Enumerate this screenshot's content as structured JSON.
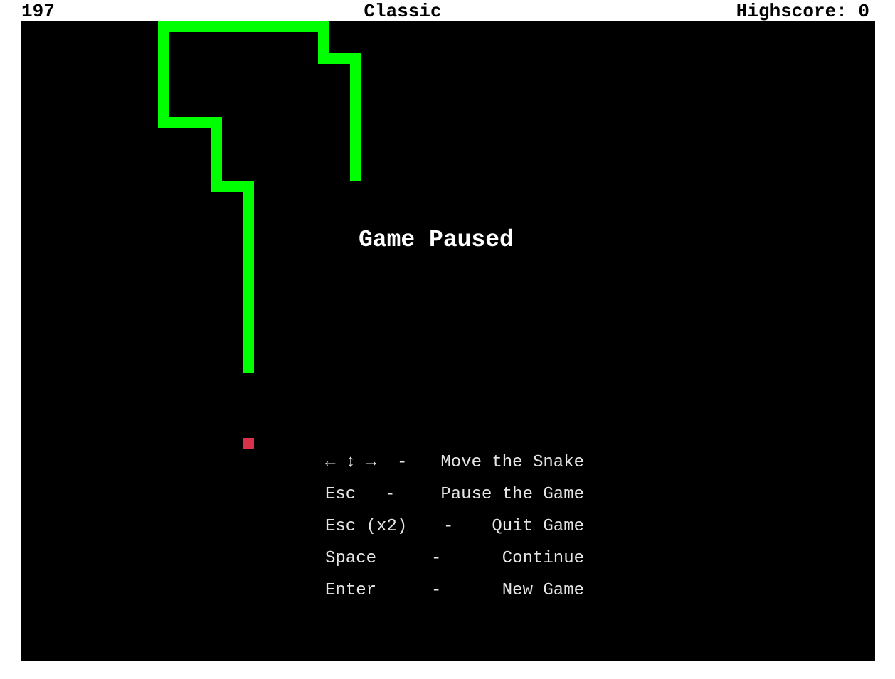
{
  "header": {
    "score": "197",
    "mode": "Classic",
    "highscore": "Highscore: 0"
  },
  "game": {
    "background_color": "#000000",
    "snake_color": "#00ff00",
    "food_color": "#d8324a",
    "grid_cell_size": 15,
    "snake_cells": [
      [
        31,
        14
      ],
      [
        31,
        13
      ],
      [
        31,
        12
      ],
      [
        31,
        11
      ],
      [
        31,
        10
      ],
      [
        31,
        9
      ],
      [
        31,
        8
      ],
      [
        31,
        7
      ],
      [
        31,
        6
      ],
      [
        31,
        5
      ],
      [
        31,
        4
      ],
      [
        31,
        3
      ],
      [
        30,
        3
      ],
      [
        29,
        3
      ],
      [
        28,
        3
      ],
      [
        28,
        2
      ],
      [
        28,
        1
      ],
      [
        28,
        0
      ],
      [
        27,
        0
      ],
      [
        26,
        0
      ],
      [
        25,
        0
      ],
      [
        24,
        0
      ],
      [
        23,
        0
      ],
      [
        22,
        0
      ],
      [
        21,
        0
      ],
      [
        20,
        0
      ],
      [
        19,
        0
      ],
      [
        18,
        0
      ],
      [
        17,
        0
      ],
      [
        16,
        0
      ],
      [
        15,
        0
      ],
      [
        14,
        0
      ],
      [
        13,
        0
      ],
      [
        13,
        1
      ],
      [
        13,
        2
      ],
      [
        13,
        3
      ],
      [
        13,
        4
      ],
      [
        13,
        5
      ],
      [
        13,
        6
      ],
      [
        13,
        7
      ],
      [
        13,
        8
      ],
      [
        13,
        9
      ],
      [
        14,
        9
      ],
      [
        15,
        9
      ],
      [
        16,
        9
      ],
      [
        17,
        9
      ],
      [
        18,
        9
      ],
      [
        18,
        10
      ],
      [
        18,
        11
      ],
      [
        18,
        12
      ],
      [
        18,
        13
      ],
      [
        18,
        14
      ],
      [
        18,
        15
      ],
      [
        19,
        15
      ],
      [
        20,
        15
      ],
      [
        21,
        15
      ],
      [
        21,
        16
      ],
      [
        21,
        17
      ],
      [
        21,
        18
      ],
      [
        21,
        19
      ],
      [
        21,
        20
      ],
      [
        21,
        21
      ],
      [
        21,
        22
      ],
      [
        21,
        23
      ],
      [
        21,
        24
      ],
      [
        21,
        25
      ],
      [
        21,
        26
      ],
      [
        21,
        27
      ],
      [
        21,
        28
      ],
      [
        21,
        29
      ],
      [
        21,
        30
      ],
      [
        21,
        31
      ],
      [
        21,
        32
      ]
    ],
    "food_cell": [
      21,
      39
    ]
  },
  "pause_overlay": {
    "title": "Game Paused",
    "controls": [
      {
        "key": "← ↕ →",
        "sep": "-",
        "action": "Move the Snake"
      },
      {
        "key": "Esc",
        "sep": "-",
        "action": "Pause the Game"
      },
      {
        "key": "Esc (x2)",
        "sep": "-",
        "action": "Quit Game"
      },
      {
        "key": "Space",
        "sep": "-",
        "action": "Continue"
      },
      {
        "key": "Enter",
        "sep": "-",
        "action": "New Game"
      }
    ]
  }
}
